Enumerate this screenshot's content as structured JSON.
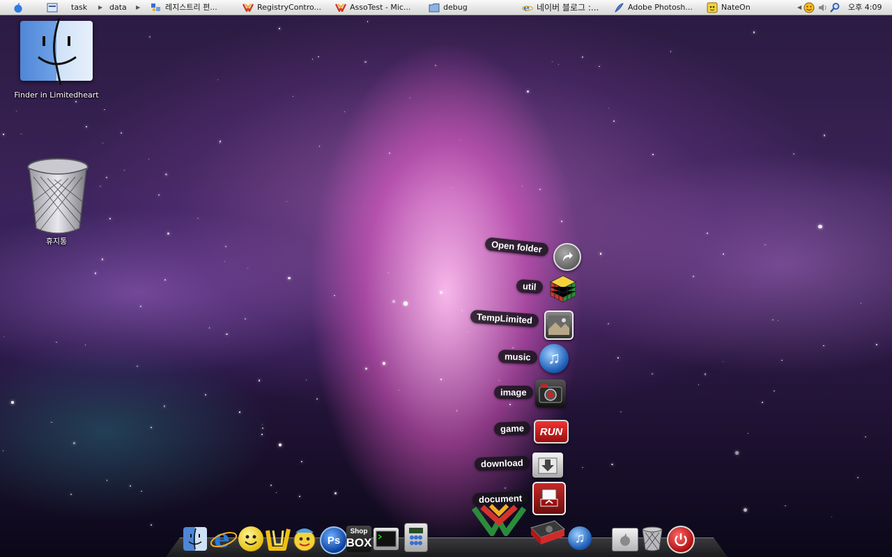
{
  "menubar": {
    "apple_icon": "apple-icon",
    "items": [
      {
        "label": "task",
        "icon": "finder-small-icon"
      },
      {
        "label": "data",
        "icon": ""
      },
      {
        "label": "레지스트리 편...",
        "icon": "registry-editor-icon"
      },
      {
        "label": "RegistryContro...",
        "icon": "visual-studio-icon"
      },
      {
        "label": "AssoTest - Mic...",
        "icon": "visual-studio-icon"
      },
      {
        "label": "debug",
        "icon": "folder-icon"
      },
      {
        "label": "네이버 블로그 :...",
        "icon": "internet-explorer-icon"
      },
      {
        "label": "Adobe Photosh...",
        "icon": "photoshop-feather-icon"
      },
      {
        "label": "NateOn",
        "icon": "nateon-icon"
      }
    ],
    "clock": "오후 4:09"
  },
  "desktop": {
    "finder_label": "Finder in Limitedheart",
    "trash_label": "휴지통"
  },
  "stack": [
    {
      "label": "Open folder",
      "icon": "open-folder-arrow-icon"
    },
    {
      "label": "util",
      "icon": "rubiks-cube-icon"
    },
    {
      "label": "TempLimited",
      "icon": "photo-frame-icon"
    },
    {
      "label": "music",
      "icon": "itunes-icon"
    },
    {
      "label": "image",
      "icon": "camera-icon"
    },
    {
      "label": "game",
      "icon": "run-icon"
    },
    {
      "label": "download",
      "icon": "download-box-icon"
    },
    {
      "label": "document",
      "icon": "document-tray-icon"
    }
  ],
  "dock": {
    "run_text": "RUN",
    "ps_text": "Ps",
    "shop_text": "Shop",
    "box_text": "BOX",
    "items": [
      "finder-icon",
      "internet-explorer-icon",
      "smiley-icon",
      "u-app-icon",
      "nateon-icon",
      "photoshop-icon",
      "shopbox-icon",
      "terminal-icon",
      "calculator-icon",
      "visual-studio-icon",
      "hard-drive-icon",
      "itunes-icon",
      "apple-system-icon",
      "trash-icon",
      "power-icon"
    ]
  }
}
